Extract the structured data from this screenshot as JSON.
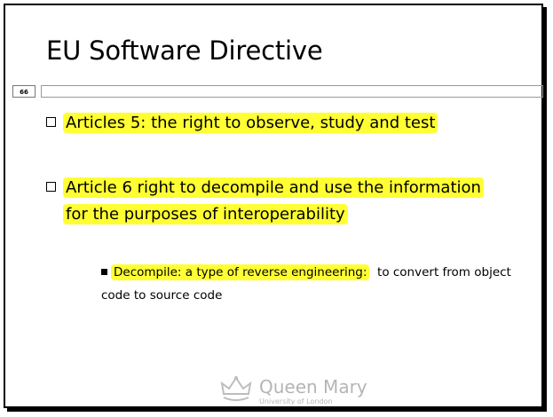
{
  "slide": {
    "title": "EU Software Directive",
    "number": "66",
    "bullets": [
      "Articles 5: the right to observe, study and test",
      "Article 6 right to decompile and use the information",
      "for the purposes of interoperability"
    ],
    "sub_bullet": {
      "highlight": "Decompile: a type of reverse engineering:",
      "rest": "to convert from object code to source code"
    },
    "logo": {
      "name": "Queen Mary",
      "subtitle": "University of London",
      "icon": "crown-icon"
    }
  }
}
